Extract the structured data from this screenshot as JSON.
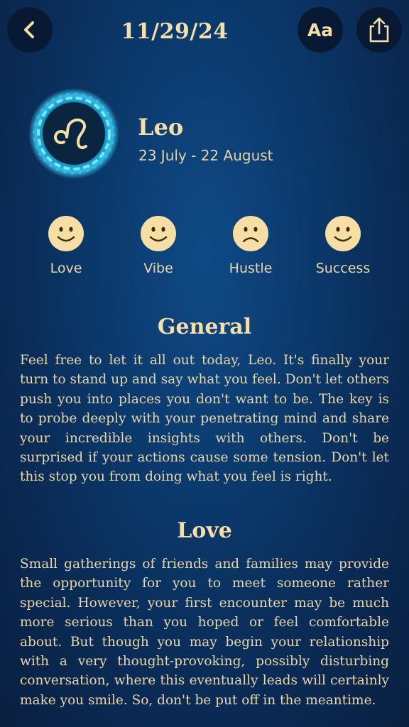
{
  "header": {
    "date": "11/29/24",
    "back_icon": "chevron-left-icon",
    "font_button_label": "Aa",
    "share_icon": "share-icon"
  },
  "sign": {
    "name": "Leo",
    "dates": "23 July - 22 August",
    "emblem_icon": "leo-zodiac-icon",
    "emblem_color": "#3fd8ff"
  },
  "moods": [
    {
      "label": "Love",
      "face": "happy"
    },
    {
      "label": "Vibe",
      "face": "happy"
    },
    {
      "label": "Hustle",
      "face": "sad"
    },
    {
      "label": "Success",
      "face": "happy"
    }
  ],
  "sections": {
    "general": {
      "title": "General",
      "body": "Feel free to let it all out today, Leo. It's finally your turn to stand up and say what you feel. Don't let others push you into places you don't want to be. The key is to probe deeply with your penetrating mind and share your incredible insights with others. Don't be surprised if your actions cause some tension. Don't let this stop you from doing what you feel is right."
    },
    "love": {
      "title": "Love",
      "body": "Small gatherings of friends and families may provide the opportunity for you to meet someone rather special. However, your first encounter may be much more serious than you hoped or feel comfortable about. But though you may begin your relationship with a very thought-provoking, possibly disturbing conversation, where this eventually leads will certainly make you smile. So, don't be put off in the meantime."
    }
  },
  "colors": {
    "accent": "#f6dfa6",
    "face_fill": "#f7dfa4",
    "button_bg": "#081a33",
    "background": "#0b3a6d"
  }
}
